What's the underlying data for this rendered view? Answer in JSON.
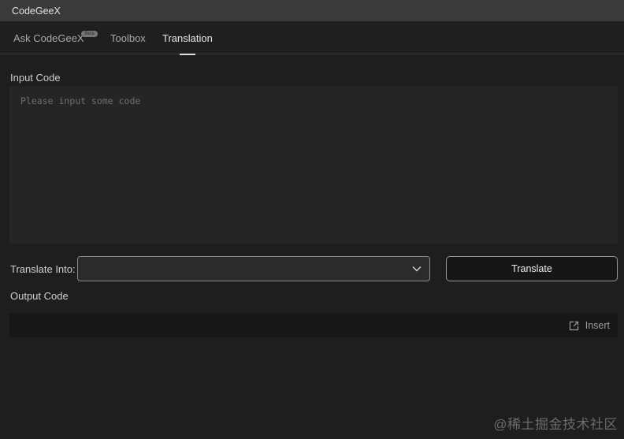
{
  "window": {
    "title": "CodeGeeX"
  },
  "tabs": [
    {
      "label": "Ask CodeGeeX",
      "badge": "Beta",
      "active": false
    },
    {
      "label": "Toolbox",
      "active": false
    },
    {
      "label": "Translation",
      "active": true
    }
  ],
  "input": {
    "label": "Input Code",
    "placeholder": "Please input some code",
    "value": ""
  },
  "translate": {
    "into_label": "Translate Into:",
    "selected": "",
    "button_label": "Translate"
  },
  "output": {
    "label": "Output Code",
    "insert_label": "Insert"
  },
  "watermark": "@稀土掘金技术社区",
  "icons": {
    "dropdown": "chevron-down-icon",
    "insert": "insert-external-icon"
  },
  "colors": {
    "background": "#1e1e1e",
    "titlebar": "#3a3a3a",
    "input_bg": "#252525"
  }
}
